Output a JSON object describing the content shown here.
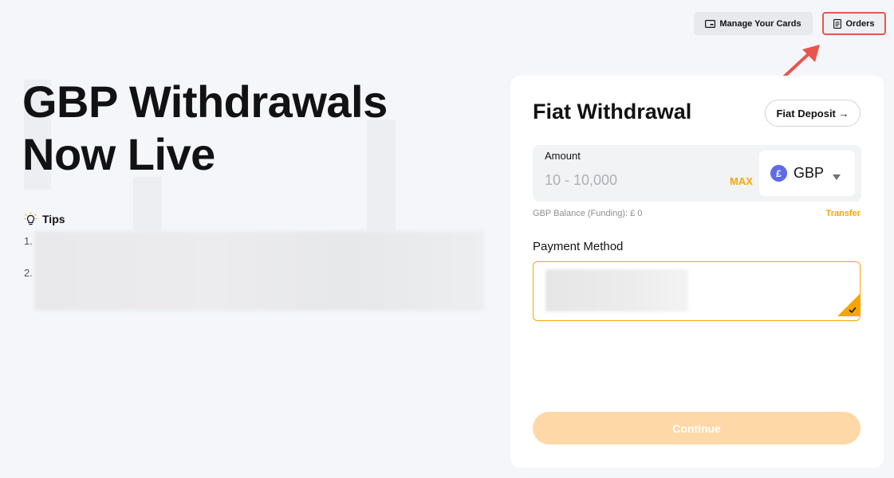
{
  "header": {
    "manage_cards_label": "Manage Your Cards",
    "orders_label": "Orders"
  },
  "hero": {
    "title_line1": "GBP Withdrawals",
    "title_line2": "Now Live"
  },
  "tips": {
    "heading": "Tips",
    "items": [
      {
        "number": "1."
      },
      {
        "number": "2."
      }
    ]
  },
  "withdraw_card": {
    "title": "Fiat Withdrawal",
    "deposit_button": "Fiat Deposit →",
    "amount": {
      "label": "Amount",
      "value": "",
      "placeholder": "10 - 10,000",
      "max_label": "MAX"
    },
    "currency": {
      "symbol": "£",
      "code": "GBP"
    },
    "balance_text": "GBP Balance (Funding): £ 0",
    "transfer_label": "Transfer",
    "payment_method_label": "Payment Method",
    "continue_label": "Continue"
  },
  "colors": {
    "accent": "#f7a600",
    "highlight_annotation": "#e8554f",
    "continue_disabled": "#ffd8a7",
    "coin": "#5d6bea"
  },
  "icons": {
    "manage_cards": "card-icon",
    "orders": "document-icon",
    "tips": "lightbulb-icon",
    "currency_caret": "caret-down-icon",
    "payment_selected": "checkmark-icon"
  }
}
